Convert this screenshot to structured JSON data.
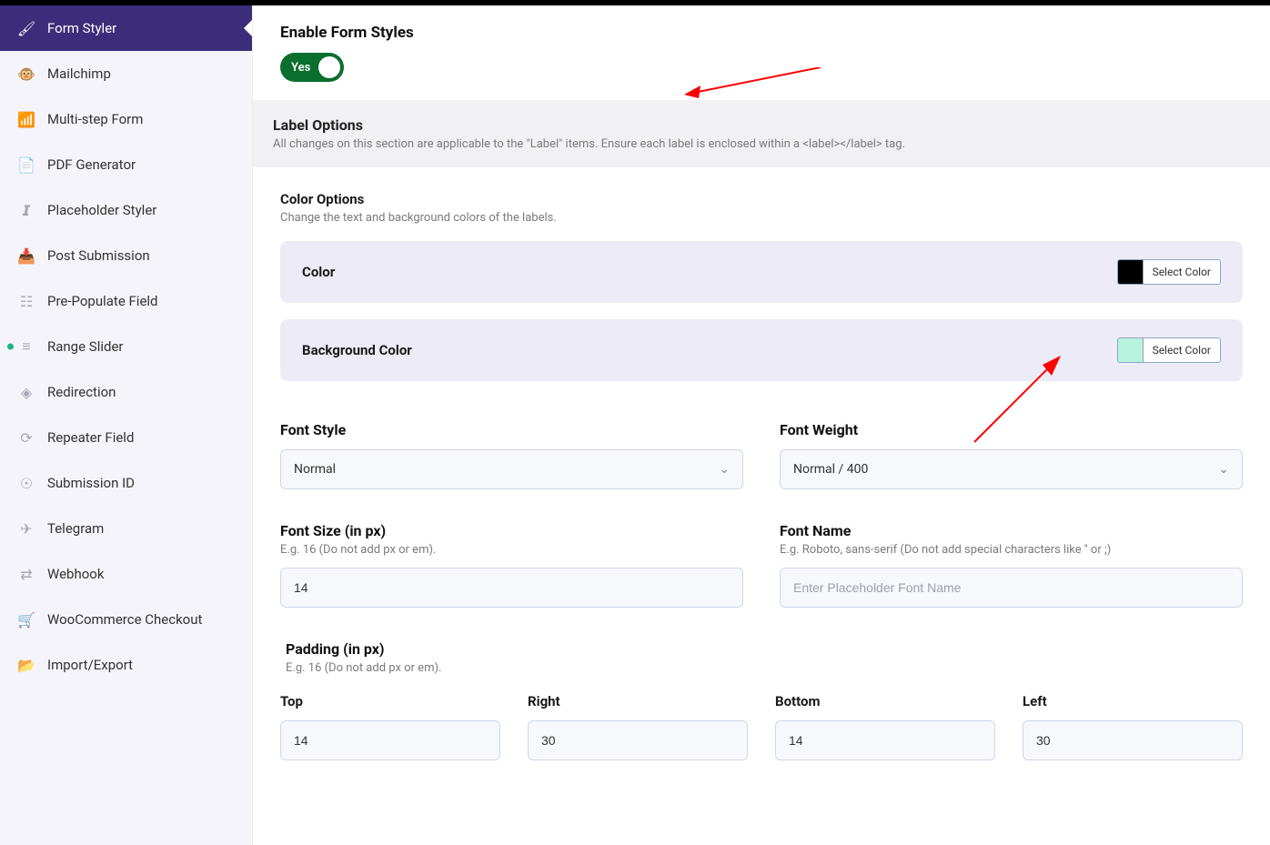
{
  "sidebar": {
    "items": [
      {
        "label": "Form Styler",
        "icon": "🖌"
      },
      {
        "label": "Mailchimp",
        "icon": "🐵"
      },
      {
        "label": "Multi-step Form",
        "icon": "📶"
      },
      {
        "label": "PDF Generator",
        "icon": "📄"
      },
      {
        "label": "Placeholder Styler",
        "icon": "𝙄"
      },
      {
        "label": "Post Submission",
        "icon": "📥"
      },
      {
        "label": "Pre-Populate Field",
        "icon": "☷"
      },
      {
        "label": "Range Slider",
        "icon": "≡"
      },
      {
        "label": "Redirection",
        "icon": "◈"
      },
      {
        "label": "Repeater Field",
        "icon": "⟳"
      },
      {
        "label": "Submission ID",
        "icon": "☉"
      },
      {
        "label": "Telegram",
        "icon": "✈"
      },
      {
        "label": "Webhook",
        "icon": "⇄"
      },
      {
        "label": "WooCommerce Checkout",
        "icon": "🛒"
      },
      {
        "label": "Import/Export",
        "icon": "📂"
      }
    ],
    "active_index": 0,
    "dotted_index": 7
  },
  "enable": {
    "title": "Enable Form Styles",
    "toggle_label": "Yes"
  },
  "label_section": {
    "title": "Label Options",
    "desc": "All changes on this section are applicable to the \"Label\" items. Ensure each label is enclosed within a <label></label> tag."
  },
  "color_options": {
    "title": "Color Options",
    "desc": "Change the text and background colors of the labels.",
    "color_label": "Color",
    "bg_label": "Background Color",
    "select_label": "Select Color",
    "color_value": "#000000",
    "bg_value": "#b8f3dd"
  },
  "font_style": {
    "label": "Font Style",
    "value": "Normal"
  },
  "font_weight": {
    "label": "Font Weight",
    "value": "Normal / 400"
  },
  "font_size": {
    "label": "Font Size (in px)",
    "hint": "E.g. 16 (Do not add px or em).",
    "value": "14"
  },
  "font_name": {
    "label": "Font Name",
    "hint": "E.g. Roboto, sans-serif (Do not add special characters like '' or ;)",
    "placeholder": "Enter Placeholder Font Name"
  },
  "padding": {
    "title": "Padding (in px)",
    "hint": "E.g. 16 (Do not add px or em).",
    "top_label": "Top",
    "right_label": "Right",
    "bottom_label": "Bottom",
    "left_label": "Left",
    "top": "14",
    "right": "30",
    "bottom": "14",
    "left": "30"
  }
}
